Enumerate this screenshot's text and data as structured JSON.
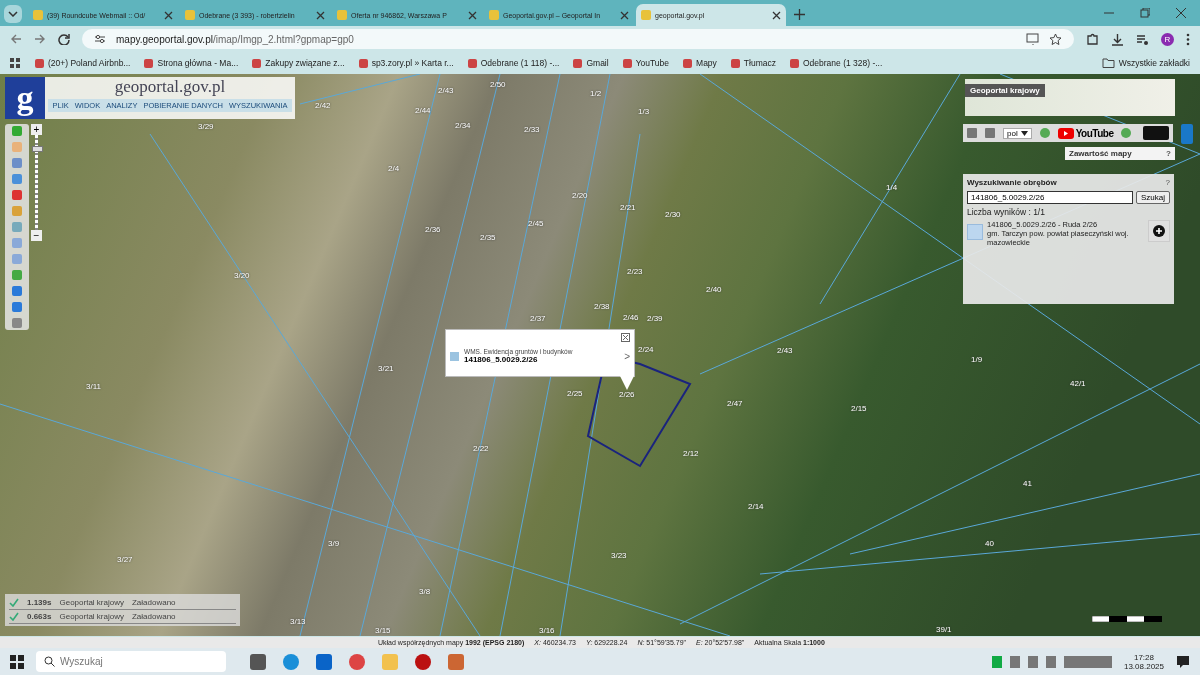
{
  "browser": {
    "tabs": [
      {
        "title": "(39) Roundcube Webmail :: Od/",
        "selected": false
      },
      {
        "title": "Odebrane (3 393) - robertzielin",
        "selected": false
      },
      {
        "title": "Oferta nr 946862, Warszawa P",
        "selected": false
      },
      {
        "title": "Geoportal.gov.pl – Geoportal In",
        "selected": false
      },
      {
        "title": "geoportal.gov.pl",
        "selected": true
      }
    ],
    "address": {
      "host": "mapy.geoportal.gov.pl",
      "path": "/imap/Imgp_2.html?gpmap=gp0"
    },
    "profile": "R",
    "bookmarks": [
      "(20+) Poland Airbnb...",
      "Strona główna - Ma...",
      "Zakupy związane z...",
      "sp3.zory.pl » Karta r...",
      "Odebrane (1 118) -...",
      "Gmail",
      "YouTube",
      "Mapy",
      "Tłumacz",
      "Odebrane (1 328) -..."
    ],
    "all_bookmarks": "Wszystkie zakładki"
  },
  "geoportal": {
    "logo_letter": "g",
    "logo_text": "geoportal.gov.pl",
    "menu": [
      "PLIK",
      "WIDOK",
      "ANALIZY",
      "POBIERANIE DANYCH",
      "WYSZUKIWANIA"
    ],
    "zoom_in": "+",
    "zoom_out": "−",
    "zoom_slider": {
      "level": 0.85
    },
    "minimap_title": "Geoportal krajowy",
    "language": "pol",
    "youtube": "YouTube",
    "map_contents": {
      "title": "Zawartość mapy",
      "help": "?"
    },
    "search_panel": {
      "title": "Wyszukiwanie obrębów",
      "help": "?",
      "value": "141806_5.0029.2/26",
      "button": "Szukaj",
      "count": "Liczba wyników : 1/1",
      "result": {
        "title": "141806_5.0029.2/26 - Ruda 2/26",
        "description": "gm. Tarczyn pow. powiat piaseczyński woj. mazowieckie"
      }
    },
    "popup": {
      "layer": "WMS. Ewidencja gruntów i budynków",
      "parcel": "141806_5.0029.2/26",
      "next": ">"
    },
    "parcel_labels": [
      "3/29",
      "2/42",
      "2/43",
      "2/50",
      "1/2",
      "2/44",
      "2/34",
      "2/33",
      "1/3",
      "2/4",
      "2/20",
      "2/21",
      "2/36",
      "2/35",
      "2/45",
      "2/30",
      "1/4",
      "3/20",
      "2/23",
      "2/40",
      "2/38",
      "2/37",
      "2/46",
      "2/39",
      "2/24",
      "2/43",
      "1/9",
      "42/1",
      "3/21",
      "3/11",
      "2/25",
      "2/26",
      "2/47",
      "2/15",
      "2/22",
      "2/12",
      "41",
      "2/14",
      "3/23",
      "40",
      "3/27",
      "3/9",
      "3/8",
      "3/13",
      "3/15",
      "3/16",
      "39/1"
    ],
    "load_status": [
      {
        "time": "1.139s",
        "source": "Geoportal krajowy",
        "status": "Załadowano"
      },
      {
        "time": "0.663s",
        "source": "Geoportal krajowy",
        "status": "Załadowano"
      }
    ],
    "status_bar": [
      "Układ współrzędnych mapy **1992 (EPSG 2180)**",
      "*X:* 460234.73",
      "*Y:* 629228.24",
      "*N:* 51°59'35.79\"",
      "*E:* 20°52'57.98\"",
      "Aktualna Skala **1:1000**"
    ]
  },
  "taskbar": {
    "search_placeholder": "Wyszukaj",
    "time": "17:28",
    "date": "13.08.2025"
  }
}
